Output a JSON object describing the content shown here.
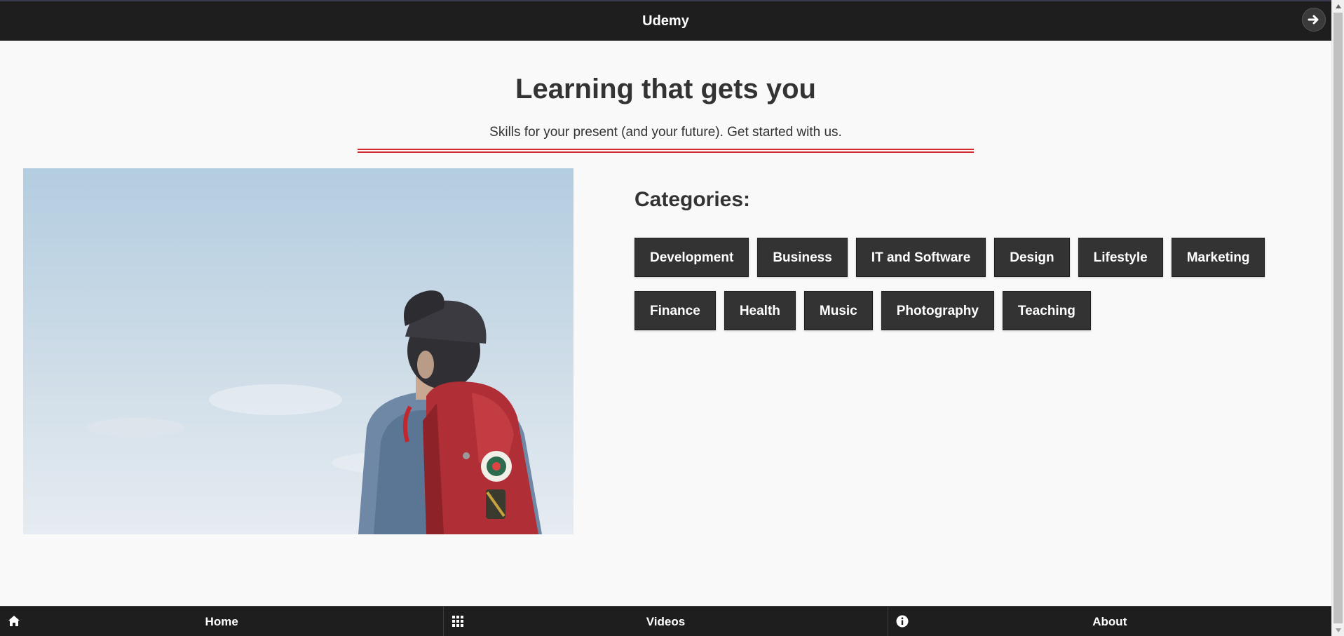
{
  "header": {
    "title": "Udemy",
    "action_icon": "arrow-right-icon"
  },
  "hero": {
    "title": "Learning that gets you",
    "subtitle": "Skills for your present (and your future). Get started with us.",
    "rule_color": "#d42a2a"
  },
  "image": {
    "description_icon": "person-with-backpack-photo"
  },
  "categories": {
    "heading": "Categories:",
    "items": [
      {
        "label": "Development"
      },
      {
        "label": "Business"
      },
      {
        "label": "IT and Software"
      },
      {
        "label": "Design"
      },
      {
        "label": "Lifestyle"
      },
      {
        "label": "Marketing"
      },
      {
        "label": "Finance"
      },
      {
        "label": "Health"
      },
      {
        "label": "Music"
      },
      {
        "label": "Photography"
      },
      {
        "label": "Teaching"
      }
    ]
  },
  "footer": {
    "items": [
      {
        "label": "Home",
        "icon": "home-icon"
      },
      {
        "label": "Videos",
        "icon": "grid-icon"
      },
      {
        "label": "About",
        "icon": "info-icon"
      }
    ]
  },
  "colors": {
    "bar_background": "#1e1e1e",
    "button_background": "#333333",
    "page_background": "#f9f9f9",
    "accent": "#d42a2a"
  }
}
